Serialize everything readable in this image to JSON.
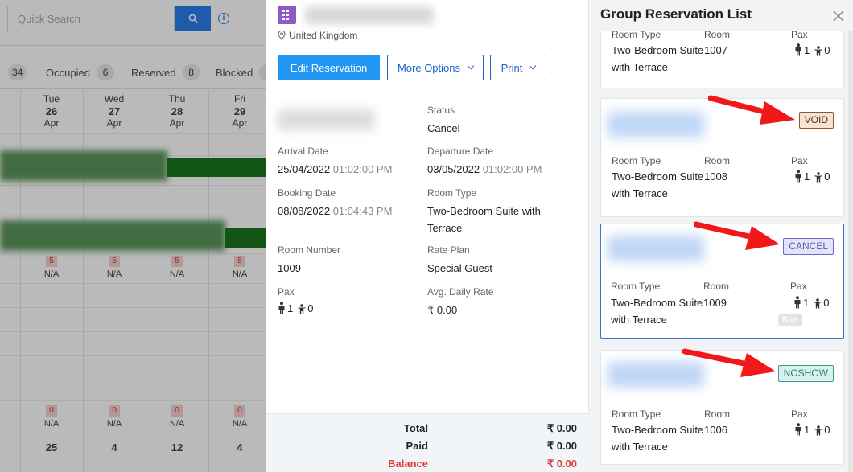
{
  "background": {
    "search_placeholder": "Quick Search",
    "legend": [
      {
        "label": "",
        "count": "34"
      },
      {
        "label": "Occupied",
        "count": "6"
      },
      {
        "label": "Reserved",
        "count": "8"
      },
      {
        "label": "Blocked",
        "count": "4"
      }
    ],
    "days": [
      {
        "dow": "Tue",
        "date": "26",
        "month": "Apr"
      },
      {
        "dow": "Wed",
        "date": "27",
        "month": "Apr"
      },
      {
        "dow": "Thu",
        "date": "28",
        "month": "Apr"
      },
      {
        "dow": "Fri",
        "date": "29",
        "month": "Apr"
      }
    ],
    "avail_row1": {
      "count": "5",
      "status": "N/A"
    },
    "avail_row2": {
      "count": "0",
      "status": "N/A"
    },
    "totals": [
      "25",
      "4",
      "12",
      "4"
    ]
  },
  "reservation": {
    "location": "United Kingdom",
    "edit_button": "Edit Reservation",
    "more_options_button": "More Options",
    "print_button": "Print",
    "status_label": "Status",
    "status_value": "Cancel",
    "arrival_label": "Arrival Date",
    "arrival_date": "25/04/2022",
    "arrival_time": "01:02:00 PM",
    "departure_label": "Departure Date",
    "departure_date": "03/05/2022",
    "departure_time": "01:02:00 PM",
    "booking_label": "Booking Date",
    "booking_date": "08/08/2022",
    "booking_time": "01:04:43 PM",
    "room_type_label": "Room Type",
    "room_type_line1": "Two-Bedroom Suite with",
    "room_type_line2": "Terrace",
    "room_number_label": "Room Number",
    "room_number": "1009",
    "rate_plan_label": "Rate Plan",
    "rate_plan": "Special Guest",
    "pax_label": "Pax",
    "pax_adults": "1",
    "pax_children": "0",
    "adr_label": "Avg. Daily Rate",
    "adr_value": "₹ 0.00",
    "total_label": "Total",
    "total_value": "₹ 0.00",
    "paid_label": "Paid",
    "paid_value": "₹ 0.00",
    "balance_label": "Balance",
    "balance_value": "₹ 0.00"
  },
  "group": {
    "title": "Group Reservation List",
    "room_type_label": "Room Type",
    "room_label": "Room",
    "pax_label": "Pax",
    "blur_tag": "Blur",
    "cards": [
      {
        "room_type_line1": "Two-Bedroom Suite",
        "room_type_line2": "with Terrace",
        "room": "1007",
        "adults": "1",
        "children": "0"
      },
      {
        "badge": "VOID",
        "room_type_line1": "Two-Bedroom Suite",
        "room_type_line2": "with Terrace",
        "room": "1008",
        "adults": "1",
        "children": "0"
      },
      {
        "badge": "CANCEL",
        "room_type_line1": "Two-Bedroom Suite",
        "room_type_line2": "with Terrace",
        "room": "1009",
        "adults": "1",
        "children": "0"
      },
      {
        "badge": "NOSHOW",
        "room_type_line1": "Two-Bedroom Suite",
        "room_type_line2": "with Terrace",
        "room": "1006",
        "adults": "1",
        "children": "0"
      }
    ]
  },
  "colors": {
    "primary": "#2196f3",
    "outline": "#1e63c8",
    "balance": "#e53935",
    "arrow": "#f01818"
  }
}
